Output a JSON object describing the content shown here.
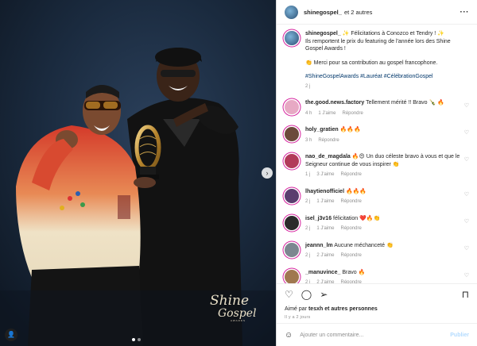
{
  "colors": {
    "accent": "#0095f6",
    "link": "#00376b",
    "muted": "#8e8e8e",
    "story_ring": "#d6249f"
  },
  "photo": {
    "next_arrow_icon": "chevron-right-icon",
    "user_tag_icon": "user-icon",
    "watermark": "Shine Gospel Awards logo"
  },
  "header": {
    "username": "shinegospel_",
    "collab": "et 2 autres",
    "more_icon": "ellipsis-icon"
  },
  "caption": {
    "username": "shinegospel_",
    "line1": "✨ Félicitations à Conozco et Tendry ! ✨",
    "line2": "Ils remportent le prix du featuring de l'année lors des Shine Gospel Awards !",
    "line3": "👏 Merci pour sa contribution au gospel francophone.",
    "hashtags": "#ShineGospelAwards #Lauréat #CélébrationGospel",
    "time": "2 j"
  },
  "comments": [
    {
      "username": "the.good.news.factory",
      "text": "Tellement mérité !! Bravo 🍾 🔥",
      "time": "4 h",
      "likes": "1 J'aime",
      "reply": "Répondre",
      "avatar_color": "#e7a9c4"
    },
    {
      "username": "holy_gratien",
      "text": "🔥🔥🔥",
      "time": "3 h",
      "likes": "",
      "reply": "Répondre",
      "avatar_color": "#6b4a3a"
    },
    {
      "username": "nao_de_magdala",
      "text": "🔥😍 Un duo céleste bravo à vous et que le Seigneur continue de vous inspirer 👏",
      "time": "1 j",
      "likes": "3 J'aime",
      "reply": "Répondre",
      "avatar_color": "#b23a5a"
    },
    {
      "username": "lhaytienofficiel",
      "text": "🔥🔥🔥",
      "time": "2 j",
      "likes": "1 J'aime",
      "reply": "Répondre",
      "avatar_color": "#5a3d6e"
    },
    {
      "username": "isel_j3v16",
      "text": "félicitation ❤️🔥👏",
      "time": "2 j",
      "likes": "1 J'aime",
      "reply": "Répondre",
      "avatar_color": "#2b2b2b"
    },
    {
      "username": "jeannn_lm",
      "text": "Aucune méchanceté 👏",
      "time": "2 j",
      "likes": "2 J'aime",
      "reply": "Répondre",
      "avatar_color": "#7c8790"
    },
    {
      "username": "_manuvince_",
      "text": "Bravo 🔥",
      "time": "2 j",
      "likes": "2 J'aime",
      "reply": "Répondre",
      "avatar_color": "#a07850"
    }
  ],
  "actions": {
    "like_icon": "heart-icon",
    "comment_icon": "comment-icon",
    "share_icon": "send-icon",
    "save_icon": "bookmark-icon",
    "liked_by_prefix": "Aimé par",
    "liked_by_user": "tesxh",
    "liked_by_suffix": "et autres personnes",
    "time": "Il y a 2 jours"
  },
  "add_comment": {
    "emoji_icon": "smiley-icon",
    "placeholder": "Ajouter un commentaire...",
    "post_label": "Publier"
  }
}
